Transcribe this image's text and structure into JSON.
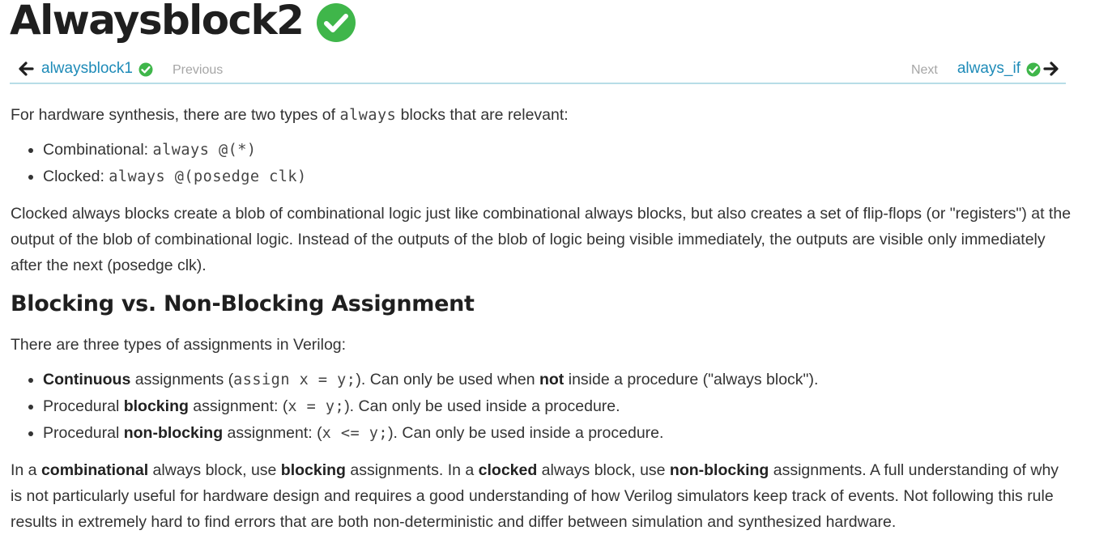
{
  "page": {
    "title": "Alwaysblock2"
  },
  "nav": {
    "prev_link": "alwaysblock1",
    "prev_hint": "Previous",
    "next_hint": "Next",
    "next_link": "always_if"
  },
  "colors": {
    "check_green": "#3fb64a",
    "link_blue": "#1e8bb8",
    "divider": "#b7dde7"
  },
  "icons": {
    "back": "arrow-left-icon",
    "forward": "arrow-right-icon",
    "completed": "check-circle-icon"
  },
  "intro": {
    "text1": "For hardware synthesis, there are two types of ",
    "code": "always",
    "text2": " blocks that are relevant:"
  },
  "always_types": [
    {
      "label": "Combinational: ",
      "code": "always @(*)"
    },
    {
      "label": "Clocked: ",
      "code": "always @(posedge clk)"
    }
  ],
  "clocked_description": "Clocked always blocks create a blob of combinational logic just like combinational always blocks, but also creates a set of flip-flops (or \"registers\") at the output of the blob of combinational logic. Instead of the outputs of the blob of logic being visible immediately, the outputs are visible only immediately after the next (posedge clk).",
  "section": {
    "heading": "Blocking vs. Non-Blocking Assignment",
    "intro": "There are three types of assignments in Verilog:"
  },
  "assignments": {
    "continuous": {
      "bold": "Continuous",
      "t1": " assignments (",
      "code": "assign x = y;",
      "t2": "). Can only be used when ",
      "bold2": "not",
      "t3": " inside a procedure (\"always block\")."
    },
    "blocking": {
      "t0": "Procedural ",
      "bold": "blocking",
      "t1": " assignment: (",
      "code": "x = y;",
      "t2": "). Can only be used inside a procedure."
    },
    "nonblocking": {
      "t0": "Procedural ",
      "bold": "non-blocking",
      "t1": " assignment: (",
      "code": "x <= y;",
      "t2": "). Can only be used inside a procedure."
    }
  },
  "rule": {
    "t0": "In a ",
    "b1": "combinational",
    "t1": " always block, use ",
    "b2": "blocking",
    "t2": " assignments. In a ",
    "b3": "clocked",
    "t3": " always block, use ",
    "b4": "non-blocking",
    "t4": " assignments. A full understanding of why is not particularly useful for hardware design and requires a good understanding of how Verilog simulators keep track of events. Not following this rule results in extremely hard to find errors that are both non-deterministic and differ between simulation and synthesized hardware."
  }
}
